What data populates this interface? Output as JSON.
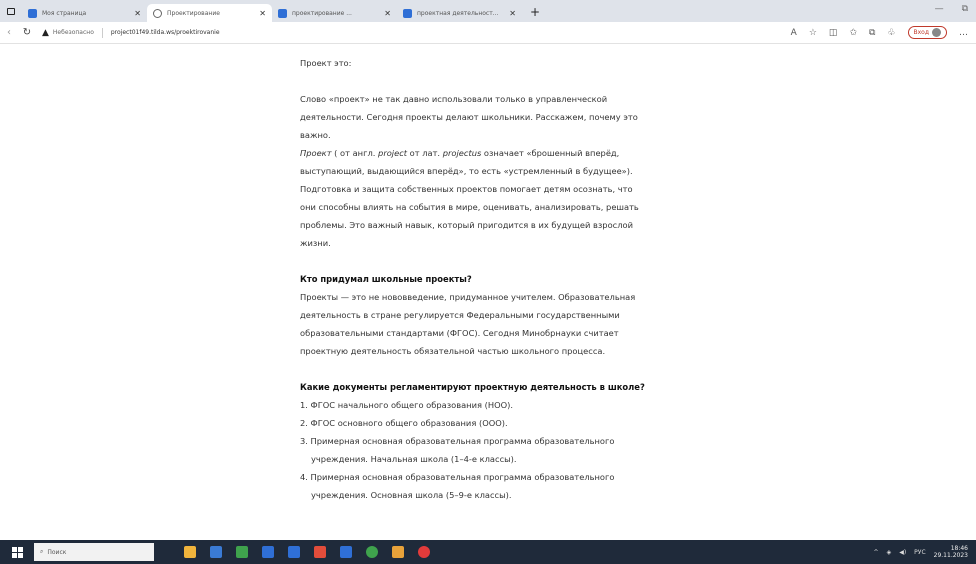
{
  "browser": {
    "tabs": [
      {
        "title": "Моя страница",
        "active": false,
        "color": "#2f6fd6"
      },
      {
        "title": "Проектирование",
        "active": true,
        "color": "#666666"
      },
      {
        "title": "проектирование ...",
        "active": false,
        "color": "#2f6fd6"
      },
      {
        "title": "проектная деятельност...",
        "active": false,
        "color": "#2f6fd6"
      }
    ],
    "address": {
      "security_label": "Небезопасно",
      "url": "project01f49.tilda.ws/proektirovanie"
    },
    "profile_label": "Вход"
  },
  "article": {
    "intro_title": "Проект это:",
    "intro_p1_l1": "Слово «проект» не так давно использовали только в управленческой",
    "intro_p1_l2": "деятельности. Сегодня проекты делают школьники. Расскажем, почему это",
    "intro_p1_l3": "важно.",
    "def_word": "Проект",
    "def_l1_a": " ( от англ. ",
    "def_l1_b": "project",
    "def_l1_c": " от лат. ",
    "def_l1_d": "projectus",
    "def_l1_e": " означает «брошенный вперёд,",
    "def_l2": "выступающий, выдающийся вперёд», то есть «устремленный в будущее»).",
    "def_l3": "Подготовка и защита собственных проектов помогает детям осознать, что",
    "def_l4": "они способны влиять на события в мире, оценивать, анализировать, решать",
    "def_l5": "проблемы. Это важный навык, который пригодится в их будущей взрослой",
    "def_l6": "жизни.",
    "h2": "Кто придумал школьные проекты?",
    "s2_l1": "Проекты — это не нововведение, придуманное учителем. Образовательная",
    "s2_l2": "деятельность в стране регулируется Федеральными государственными",
    "s2_l3": "образовательными стандартами (ФГОС). Сегодня Минобрнауки считает",
    "s2_l4": "проектную деятельность обязательной частью школьного процесса.",
    "h3": "Какие документы регламентируют проектную деятельность в школе?",
    "list": [
      {
        "l1": "1. ФГОС начального общего образования (НОО).",
        "l2": ""
      },
      {
        "l1": "2. ФГОС основного общего образования (ООО).",
        "l2": ""
      },
      {
        "l1": "3. Примерная основная образовательная программа образовательного",
        "l2": "учреждения. Начальная школа (1–4-е классы)."
      },
      {
        "l1": "4. Примерная основная образовательная программа образовательного",
        "l2": "учреждения. Основная школа (5–9-е классы)."
      }
    ]
  },
  "taskbar": {
    "search_placeholder": "Поиск",
    "lang": "РУС",
    "time": "18:46",
    "date": "29.11.2023",
    "app_colors": [
      "#f0b43c",
      "#3a7bd5",
      "#3fa34d",
      "#2f6fd6",
      "#2f6fd6",
      "#e34d3b",
      "#2f6fd6",
      "#3fa34d",
      "#e8a23a",
      "#e33b3b"
    ]
  }
}
